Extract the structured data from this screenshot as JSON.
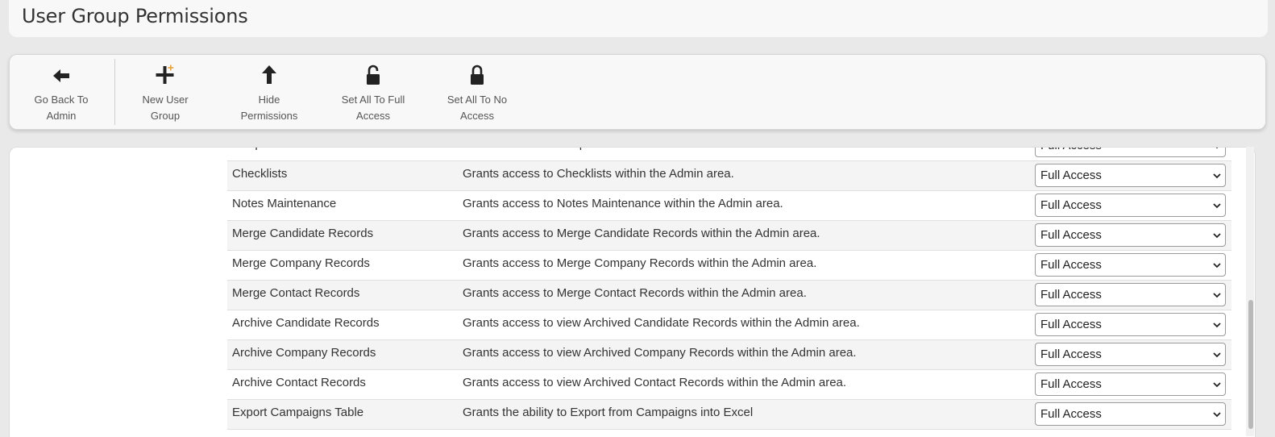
{
  "page": {
    "title": "User Group Permissions"
  },
  "toolbar": {
    "buttons": [
      {
        "label": "Go Back To\nAdmin",
        "icon": "arrow-left-icon"
      },
      {
        "label": "New User\nGroup",
        "icon": "plus-icon"
      },
      {
        "label": "Hide\nPermissions",
        "icon": "arrow-up-icon"
      },
      {
        "label": "Set All To Full\nAccess",
        "icon": "unlock-icon"
      },
      {
        "label": "Set All To No\nAccess",
        "icon": "lock-icon"
      }
    ],
    "accent_color": "#e8a33a"
  },
  "permissions": {
    "rows": [
      {
        "name": "Templates",
        "description": "Grants access to Templates within the Admin area.",
        "access": "Full Access"
      },
      {
        "name": "Checklists",
        "description": "Grants access to Checklists within the Admin area.",
        "access": "Full Access"
      },
      {
        "name": "Notes Maintenance",
        "description": "Grants access to Notes Maintenance within the Admin area.",
        "access": "Full Access"
      },
      {
        "name": "Merge Candidate Records",
        "description": "Grants access to Merge Candidate Records within the Admin area.",
        "access": "Full Access"
      },
      {
        "name": "Merge Company Records",
        "description": "Grants access to Merge Company Records within the Admin area.",
        "access": "Full Access"
      },
      {
        "name": "Merge Contact Records",
        "description": "Grants access to Merge Contact Records within the Admin area.",
        "access": "Full Access"
      },
      {
        "name": "Archive Candidate Records",
        "description": "Grants access to view Archived Candidate Records within the Admin area.",
        "access": "Full Access"
      },
      {
        "name": "Archive Company Records",
        "description": "Grants access to view Archived Company Records within the Admin area.",
        "access": "Full Access"
      },
      {
        "name": "Archive Contact Records",
        "description": "Grants access to view Archived Contact Records within the Admin area.",
        "access": "Full Access"
      },
      {
        "name": "Export Campaigns Table",
        "description": "Grants the ability to Export from Campaigns into Excel",
        "access": "Full Access"
      }
    ]
  }
}
